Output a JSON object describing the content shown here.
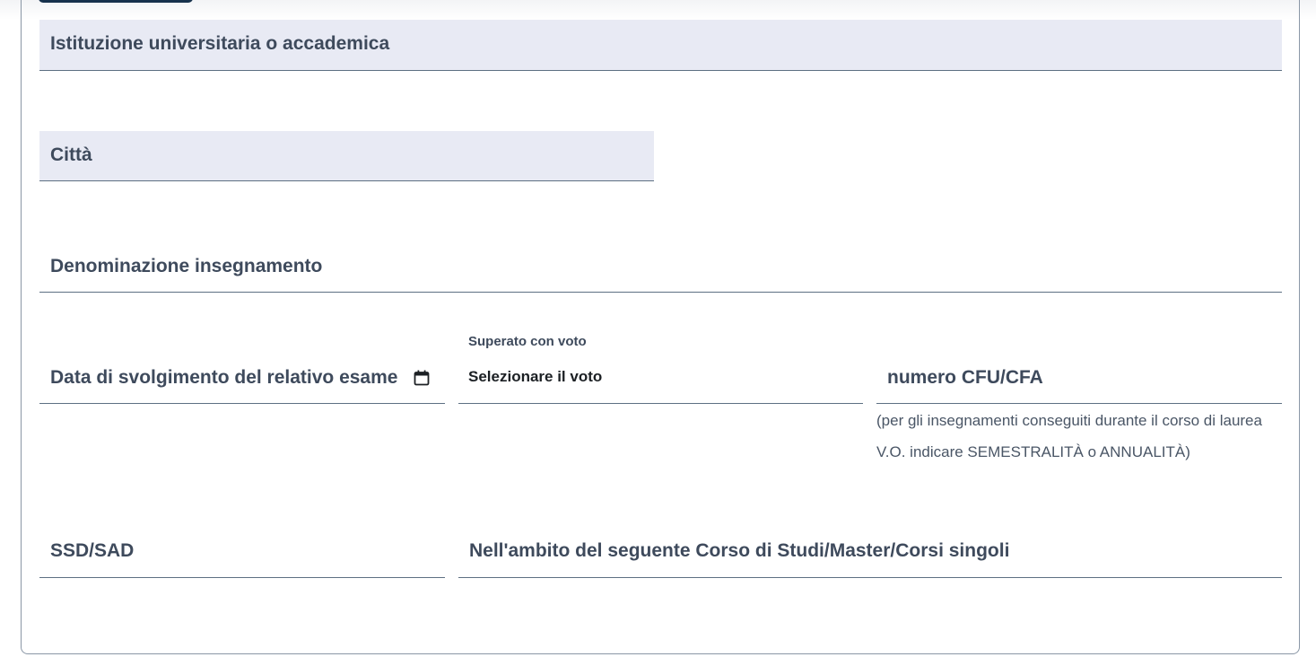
{
  "form": {
    "institution_label": "Istituzione universitaria o accademica",
    "city_label": "Città",
    "course_name_label": "Denominazione insegnamento",
    "exam_date_label": "Data di svolgimento del relativo esame",
    "grade_label": "Superato con voto",
    "grade_select_value": "Selezionare il voto",
    "cfu_label": "numero CFU/CFA",
    "cfu_help": "(per gli insegnamenti conseguiti durante il corso di laurea V.O. indicare SEMESTRALITÀ o ANNUALITÀ)",
    "ssd_label": "SSD/SAD",
    "program_label": "Nell'ambito del seguente Corso di Studi/Master/Corsi singoli"
  },
  "icons": {
    "calendar": "calendar-icon"
  },
  "colors": {
    "filled_field_bg": "#e8eaf4",
    "field_border": "#5d7083",
    "text": "#3e4a5c",
    "top_button": "#17324d"
  }
}
